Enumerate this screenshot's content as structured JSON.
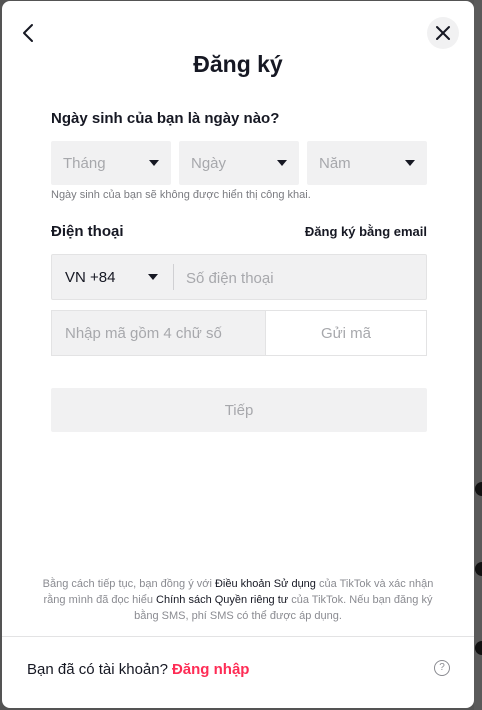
{
  "modal": {
    "title": "Đăng ký",
    "birthday": {
      "label": "Ngày sinh của bạn là ngày nào?",
      "month_placeholder": "Tháng",
      "day_placeholder": "Ngày",
      "year_placeholder": "Năm",
      "hint": "Ngày sinh của bạn sẽ không được hiển thị công khai."
    },
    "phone": {
      "label": "Điện thoại",
      "email_link": "Đăng ký bằng email",
      "country_code": "VN +84",
      "phone_placeholder": "Số điện thoại",
      "code_placeholder": "Nhập mã gồm 4 chữ số",
      "send_code_label": "Gửi mã"
    },
    "next_label": "Tiếp",
    "terms": {
      "part1": "Bằng cách tiếp tục, bạn đồng ý với ",
      "terms_link": "Điều khoản Sử dụng",
      "part2": " của TikTok và xác nhận rằng mình đã đọc hiểu ",
      "privacy_link": "Chính sách Quyền riêng tư",
      "part3": " của TikTok. Nếu bạn đăng ký bằng SMS, phí SMS có thể được áp dụng."
    },
    "footer": {
      "question": "Bạn đã có tài khoản?",
      "login_link": "Đăng nhập",
      "help_icon": "?"
    }
  },
  "icons": {
    "back": "chevron-left-icon",
    "close": "close-icon",
    "help": "question-circle-icon",
    "caret": "caret-down-icon"
  },
  "colors": {
    "accent": "#fe2c55",
    "text": "#161823",
    "placeholder": "#a7a8ac",
    "field_bg": "#f1f1f2"
  }
}
